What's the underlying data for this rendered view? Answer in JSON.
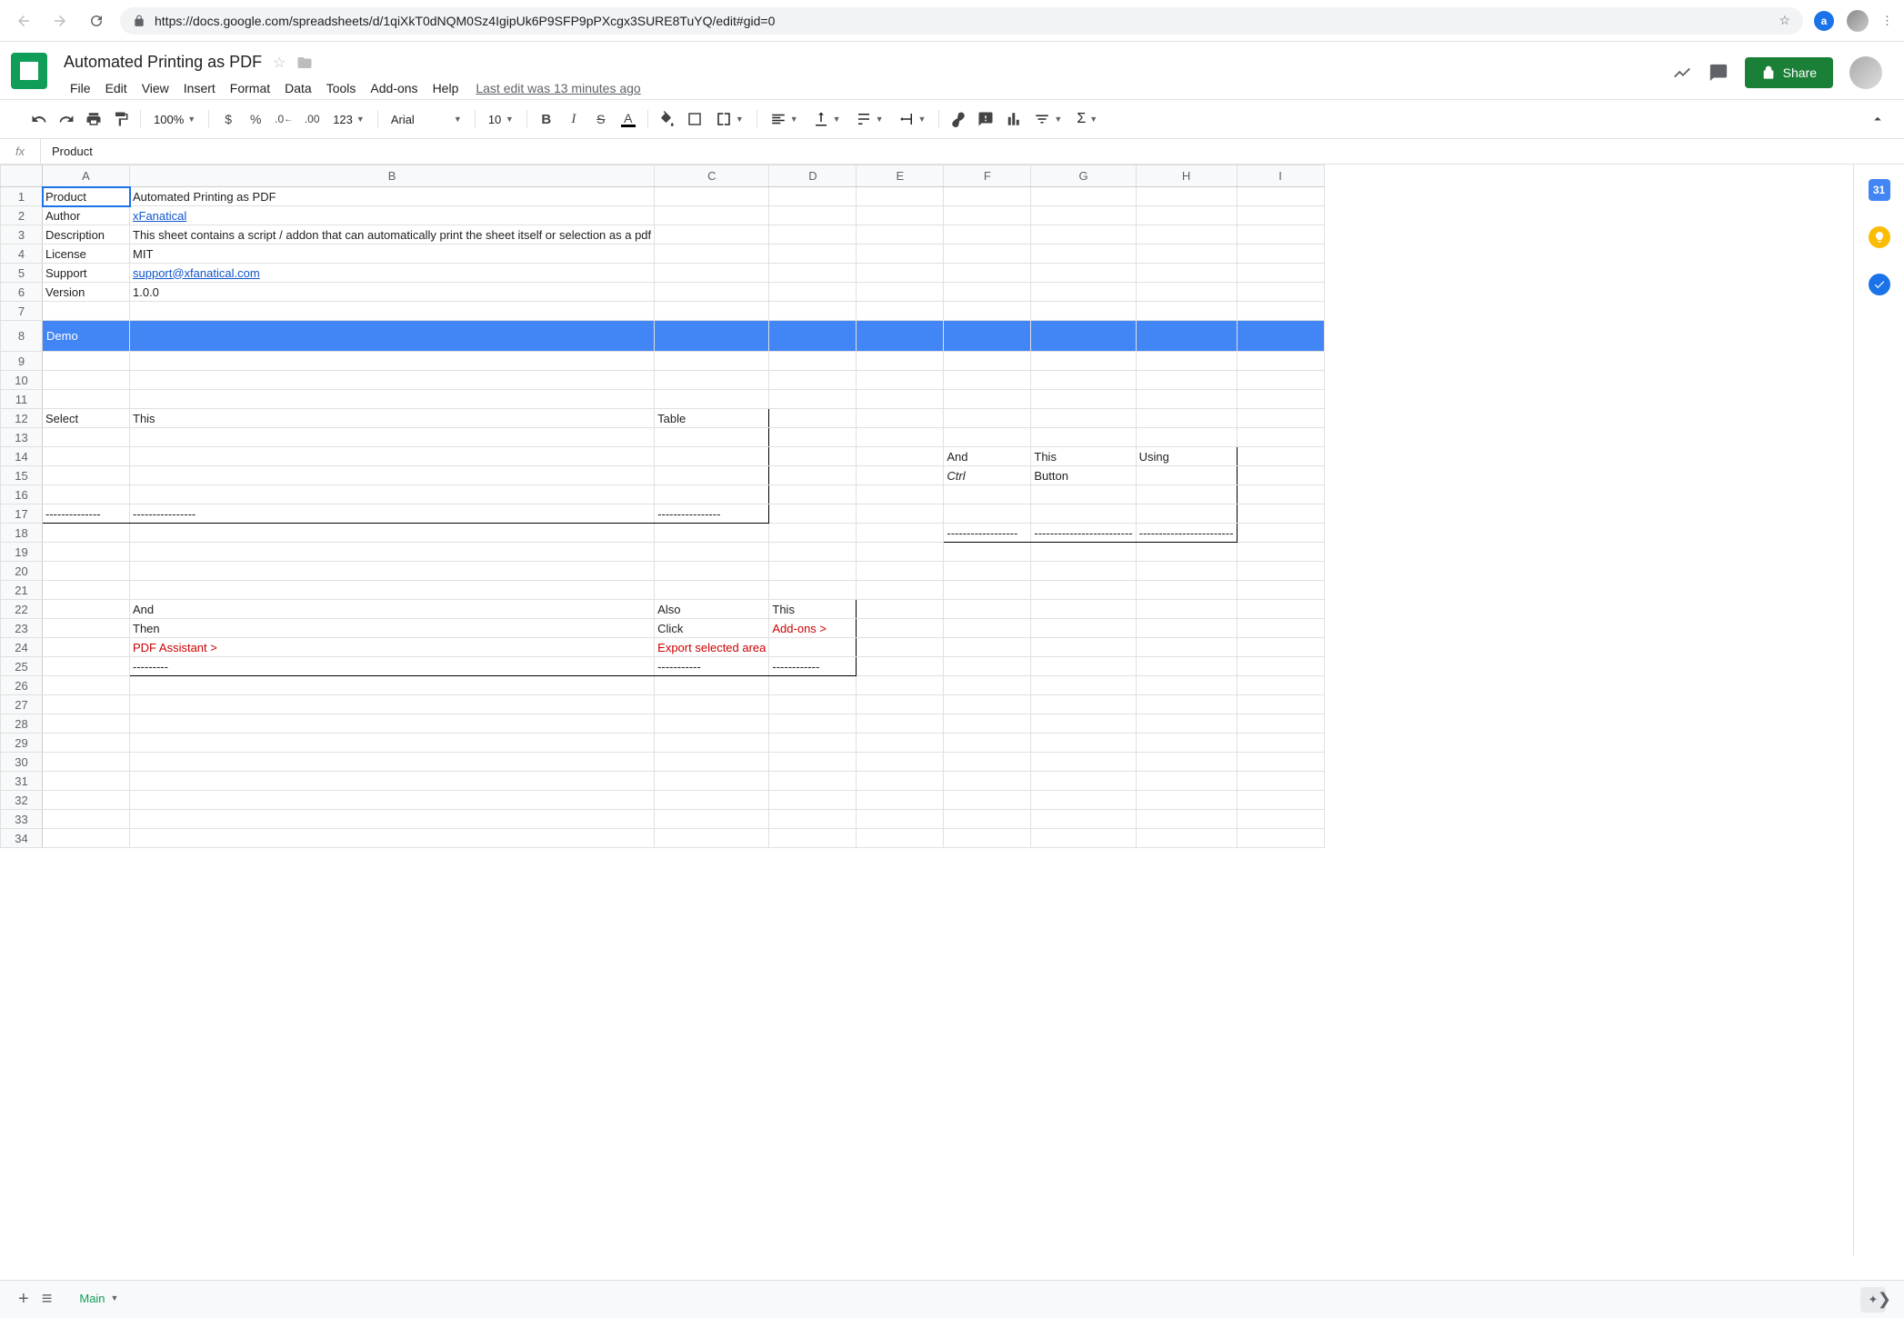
{
  "browser": {
    "url": "https://docs.google.com/spreadsheets/d/1qiXkT0dNQM0Sz4IgipUk6P9SFP9pPXcgx3SURE8TuYQ/edit#gid=0"
  },
  "doc": {
    "title": "Automated Printing as PDF",
    "last_edit": "Last edit was 13 minutes ago",
    "share_label": "Share"
  },
  "menus": {
    "file": "File",
    "edit": "Edit",
    "view": "View",
    "insert": "Insert",
    "format": "Format",
    "data": "Data",
    "tools": "Tools",
    "addons": "Add-ons",
    "help": "Help"
  },
  "toolbar": {
    "zoom": "100%",
    "font": "Arial",
    "size": "10",
    "numfmt": "123",
    "currency": "$",
    "percent": "%",
    "dec_dec": ".0",
    "dec_inc": ".00",
    "bold": "B",
    "italic": "I",
    "strike": "S",
    "textcolor": "A"
  },
  "formula": {
    "fx": "fx",
    "content": "Product"
  },
  "columns": [
    "A",
    "B",
    "C",
    "D",
    "E",
    "F",
    "G",
    "H",
    "I"
  ],
  "rows_count": 34,
  "cells": {
    "A1": "Product",
    "B1": "Automated Printing as PDF",
    "A2": "Author",
    "B2": "xFanatical",
    "A3": "Description",
    "B3": "This sheet contains a script / addon that can automatically print the sheet itself or selection as a pdf",
    "A4": "License",
    "B4": "MIT",
    "A5": "Support",
    "B5": "support@xfanatical.com",
    "A6": "Version",
    "B6": "1.0.0",
    "A8": "Demo",
    "A12": "Select",
    "B12": "This",
    "C12": "Table",
    "A17": "--------------",
    "B17": "----------------",
    "C17": "----------------",
    "F14": "And",
    "G14": "This",
    "H14": "Using",
    "F15": "Ctrl",
    "G15": "Button",
    "F18": "------------------",
    "G18": "-------------------------",
    "H18": "------------------------",
    "B22": "And",
    "C22": "Also",
    "D22": "This",
    "B23": "Then",
    "C23": "Click",
    "D23": "Add-ons >",
    "B24": "PDF Assistant >",
    "C24": "Export selected area",
    "B25": "---------",
    "C25": "-----------",
    "D25": "------------"
  },
  "tabs": {
    "main": "Main"
  },
  "side": {
    "cal": "31"
  },
  "chart_data": null
}
